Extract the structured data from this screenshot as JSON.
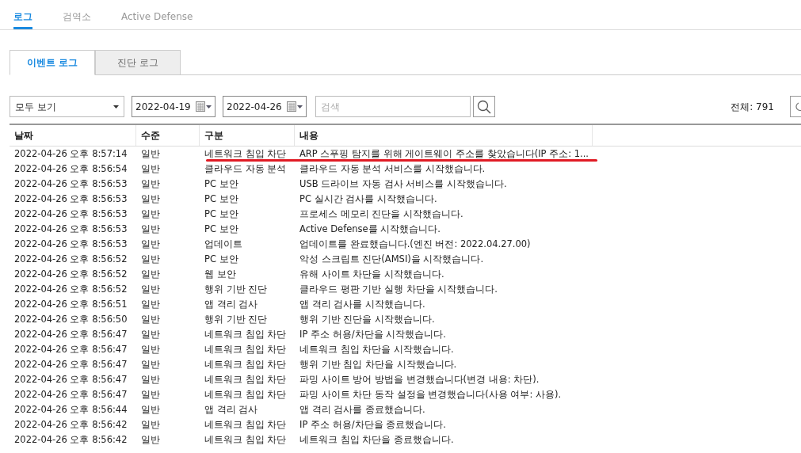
{
  "top_tabs": [
    {
      "label": "로그",
      "selected": true
    },
    {
      "label": "검역소",
      "selected": false
    },
    {
      "label": "Active Defense",
      "selected": false
    }
  ],
  "sub_tabs": [
    {
      "label": "이벤트 로그",
      "selected": true
    },
    {
      "label": "진단 로그",
      "selected": false
    }
  ],
  "filter": {
    "value": "모두 보기"
  },
  "date_from": "2022-04-19",
  "date_to": "2022-04-26",
  "search": {
    "placeholder": "검색"
  },
  "total": "전체: 791",
  "table": {
    "columns": [
      "날짜",
      "수준",
      "구분",
      "내용"
    ],
    "rows": [
      {
        "cells": [
          "2022-04-26 오후 8:57:14",
          "일반",
          "네트워크 침입 차단",
          "ARP 스푸핑 탐지를 위해 게이트웨이 주소를 찾았습니다(IP 주소: 1..."
        ],
        "underlined": true
      },
      {
        "cells": [
          "2022-04-26 오후 8:56:54",
          "일반",
          "클라우드 자동 분석",
          "클라우드 자동 분석 서비스를 시작했습니다."
        ],
        "underlined": false
      },
      {
        "cells": [
          "2022-04-26 오후 8:56:53",
          "일반",
          "PC 보안",
          "USB 드라이브 자동 검사 서비스를 시작했습니다."
        ],
        "underlined": false
      },
      {
        "cells": [
          "2022-04-26 오후 8:56:53",
          "일반",
          "PC 보안",
          "PC 실시간 검사를 시작했습니다."
        ],
        "underlined": false
      },
      {
        "cells": [
          "2022-04-26 오후 8:56:53",
          "일반",
          "PC 보안",
          "프로세스 메모리 진단을 시작했습니다."
        ],
        "underlined": false
      },
      {
        "cells": [
          "2022-04-26 오후 8:56:53",
          "일반",
          "PC 보안",
          "Active Defense를 시작했습니다."
        ],
        "underlined": false
      },
      {
        "cells": [
          "2022-04-26 오후 8:56:53",
          "일반",
          "업데이트",
          "업데이트를 완료했습니다.(엔진 버전: 2022.04.27.00)"
        ],
        "underlined": false
      },
      {
        "cells": [
          "2022-04-26 오후 8:56:52",
          "일반",
          "PC 보안",
          "악성 스크립트 진단(AMSI)을 시작했습니다."
        ],
        "underlined": false
      },
      {
        "cells": [
          "2022-04-26 오후 8:56:52",
          "일반",
          "웹 보안",
          "유해 사이트 차단을 시작했습니다."
        ],
        "underlined": false
      },
      {
        "cells": [
          "2022-04-26 오후 8:56:52",
          "일반",
          "행위 기반 진단",
          "클라우드 평판 기반 실행 차단을 시작했습니다."
        ],
        "underlined": false
      },
      {
        "cells": [
          "2022-04-26 오후 8:56:51",
          "일반",
          "앱 격리 검사",
          "앱 격리 검사를 시작했습니다."
        ],
        "underlined": false
      },
      {
        "cells": [
          "2022-04-26 오후 8:56:50",
          "일반",
          "행위 기반 진단",
          "행위 기반 진단을 시작했습니다."
        ],
        "underlined": false
      },
      {
        "cells": [
          "2022-04-26 오후 8:56:47",
          "일반",
          "네트워크 침입 차단",
          "IP 주소 허용/차단을 시작했습니다."
        ],
        "underlined": false
      },
      {
        "cells": [
          "2022-04-26 오후 8:56:47",
          "일반",
          "네트워크 침입 차단",
          "네트워크 침입 차단을 시작했습니다."
        ],
        "underlined": false
      },
      {
        "cells": [
          "2022-04-26 오후 8:56:47",
          "일반",
          "네트워크 침입 차단",
          "행위 기반 침입 차단을 시작했습니다."
        ],
        "underlined": false
      },
      {
        "cells": [
          "2022-04-26 오후 8:56:47",
          "일반",
          "네트워크 침입 차단",
          "파밍 사이트 방어 방법을 변경했습니다(변경 내용: 차단)."
        ],
        "underlined": false
      },
      {
        "cells": [
          "2022-04-26 오후 8:56:47",
          "일반",
          "네트워크 침입 차단",
          "파밍 사이트 차단 동작 설정을 변경했습니다(사용 여부: 사용)."
        ],
        "underlined": false
      },
      {
        "cells": [
          "2022-04-26 오후 8:56:44",
          "일반",
          "앱 격리 검사",
          "앱 격리 검사를 종료했습니다."
        ],
        "underlined": false
      },
      {
        "cells": [
          "2022-04-26 오후 8:56:42",
          "일반",
          "네트워크 침입 차단",
          "IP 주소 허용/차단을 종료했습니다."
        ],
        "underlined": false
      },
      {
        "cells": [
          "2022-04-26 오후 8:56:42",
          "일반",
          "네트워크 침입 차단",
          "네트워크 침입 차단을 종료했습니다."
        ],
        "underlined": false
      }
    ]
  }
}
